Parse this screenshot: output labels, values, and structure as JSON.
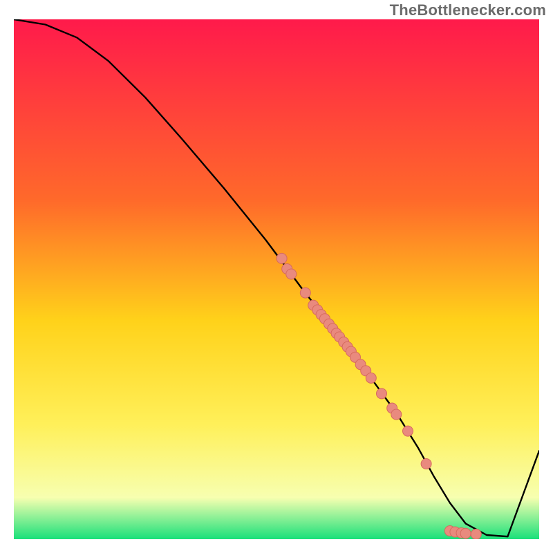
{
  "watermark": "TheBottlenecker.com",
  "colors": {
    "grad_top": "#ff1a4b",
    "grad_mid1": "#ff6a2a",
    "grad_mid2": "#ffd21a",
    "grad_mid3": "#fff05a",
    "grad_low": "#f7ffb0",
    "grad_bottom": "#19e07a",
    "curve": "#000000",
    "dot_fill": "#e98a7e",
    "dot_stroke": "#d66a5d"
  },
  "chart_data": {
    "type": "line",
    "title": "",
    "xlabel": "",
    "ylabel": "",
    "xlim": [
      0,
      100
    ],
    "ylim": [
      0,
      100
    ],
    "curve": {
      "x": [
        0,
        6,
        12,
        18,
        25,
        32,
        40,
        48,
        55,
        62,
        68,
        73,
        77,
        80,
        83,
        86,
        90,
        94,
        100
      ],
      "y": [
        100,
        99,
        96.5,
        92,
        85,
        77,
        67.5,
        57.5,
        48,
        39,
        31,
        24,
        17.5,
        12,
        7,
        3,
        0.8,
        0.5,
        17
      ]
    },
    "scatter": [
      {
        "x": 51.0,
        "y": 54.0
      },
      {
        "x": 52.0,
        "y": 52.0
      },
      {
        "x": 52.8,
        "y": 51.0
      },
      {
        "x": 55.5,
        "y": 47.4
      },
      {
        "x": 57.0,
        "y": 45.0
      },
      {
        "x": 57.8,
        "y": 44.1
      },
      {
        "x": 58.5,
        "y": 43.2
      },
      {
        "x": 59.2,
        "y": 42.4
      },
      {
        "x": 60.0,
        "y": 41.4
      },
      {
        "x": 60.7,
        "y": 40.5
      },
      {
        "x": 61.4,
        "y": 39.6
      },
      {
        "x": 62.0,
        "y": 38.9
      },
      {
        "x": 62.8,
        "y": 37.9
      },
      {
        "x": 63.5,
        "y": 37.0
      },
      {
        "x": 64.2,
        "y": 36.1
      },
      {
        "x": 65.0,
        "y": 35.0
      },
      {
        "x": 66.0,
        "y": 33.6
      },
      {
        "x": 67.0,
        "y": 32.4
      },
      {
        "x": 68.0,
        "y": 31.0
      },
      {
        "x": 70.0,
        "y": 28.0
      },
      {
        "x": 72.0,
        "y": 25.2
      },
      {
        "x": 72.8,
        "y": 24.0
      },
      {
        "x": 75.0,
        "y": 20.8
      },
      {
        "x": 78.5,
        "y": 14.5
      },
      {
        "x": 83.0,
        "y": 1.6
      },
      {
        "x": 84.0,
        "y": 1.4
      },
      {
        "x": 85.2,
        "y": 1.2
      },
      {
        "x": 86.0,
        "y": 1.1
      },
      {
        "x": 88.0,
        "y": 0.95
      }
    ]
  }
}
